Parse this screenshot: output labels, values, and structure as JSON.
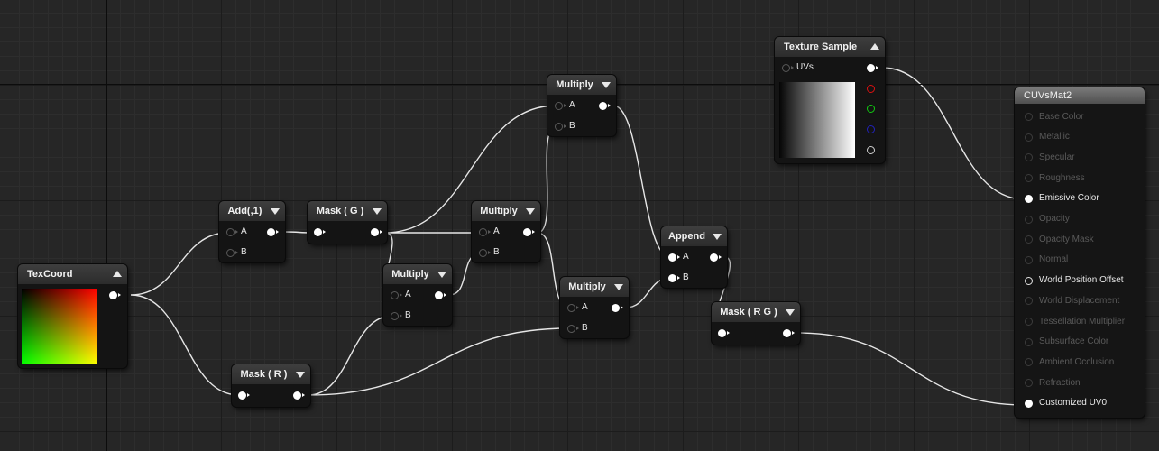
{
  "nodes": {
    "texcoord": {
      "title": "TexCoord"
    },
    "add": {
      "title": "Add(,1)",
      "pin_a": "A",
      "pin_b": "B"
    },
    "mask_g": {
      "title": "Mask ( G )"
    },
    "mask_r": {
      "title": "Mask ( R )"
    },
    "multiply_top": {
      "title": "Multiply",
      "pin_a": "A",
      "pin_b": "B"
    },
    "multiply_mid": {
      "title": "Multiply",
      "pin_a": "A",
      "pin_b": "B"
    },
    "multiply_low": {
      "title": "Multiply",
      "pin_a": "A",
      "pin_b": "B"
    },
    "multiply_right": {
      "title": "Multiply",
      "pin_a": "A",
      "pin_b": "B"
    },
    "append": {
      "title": "Append",
      "pin_a": "A",
      "pin_b": "B"
    },
    "mask_rg": {
      "title": "Mask ( R G )"
    },
    "texture_sample": {
      "title": "Texture Sample",
      "uvs_label": "UVs"
    }
  },
  "material": {
    "title": "CUVsMat2",
    "inputs": [
      {
        "label": "Base Color",
        "state": "dim"
      },
      {
        "label": "Metallic",
        "state": "dim"
      },
      {
        "label": "Specular",
        "state": "dim"
      },
      {
        "label": "Roughness",
        "state": "dim"
      },
      {
        "label": "Emissive Color",
        "state": "connected"
      },
      {
        "label": "Opacity",
        "state": "dim"
      },
      {
        "label": "Opacity Mask",
        "state": "dim"
      },
      {
        "label": "Normal",
        "state": "dim"
      },
      {
        "label": "World Position Offset",
        "state": "active"
      },
      {
        "label": "World Displacement",
        "state": "dim"
      },
      {
        "label": "Tessellation Multiplier",
        "state": "dim"
      },
      {
        "label": "Subsurface Color",
        "state": "dim"
      },
      {
        "label": "Ambient Occlusion",
        "state": "dim"
      },
      {
        "label": "Refraction",
        "state": "dim"
      },
      {
        "label": "Customized UV0",
        "state": "connected"
      }
    ]
  },
  "colors": {
    "wire": "#e6e6e6",
    "channel_r": "#dd1111",
    "channel_g": "#11cc11",
    "channel_b": "#2222bb"
  }
}
